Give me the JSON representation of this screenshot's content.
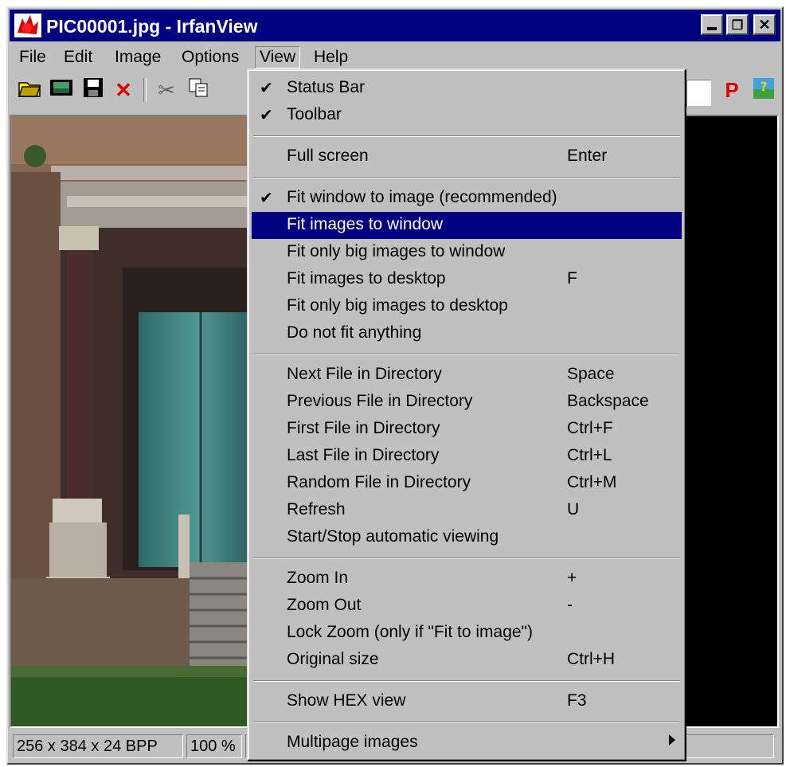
{
  "window": {
    "title": "PIC00001.jpg - IrfanView"
  },
  "menubar": {
    "items": [
      "File",
      "Edit",
      "Image",
      "Options",
      "View",
      "Help"
    ],
    "active": "View"
  },
  "toolbar": {
    "icons": [
      "open-folder-icon",
      "slideshow-icon",
      "save-icon",
      "delete-icon",
      "cut-icon",
      "copy-icon",
      "print-icon",
      "plugin-icon"
    ],
    "right_icon_letter": "P"
  },
  "view_menu": {
    "groups": [
      [
        {
          "label": "Status Bar",
          "checked": true,
          "shortcut": ""
        },
        {
          "label": "Toolbar",
          "checked": true,
          "shortcut": ""
        }
      ],
      [
        {
          "label": "Full screen",
          "checked": false,
          "shortcut": "Enter"
        }
      ],
      [
        {
          "label": "Fit window to image (recommended)",
          "checked": true,
          "shortcut": ""
        },
        {
          "label": "Fit images to window",
          "checked": false,
          "shortcut": "",
          "highlighted": true
        },
        {
          "label": "Fit only big images to window",
          "checked": false,
          "shortcut": ""
        },
        {
          "label": "Fit images to desktop",
          "checked": false,
          "shortcut": "F"
        },
        {
          "label": "Fit only big images to desktop",
          "checked": false,
          "shortcut": ""
        },
        {
          "label": "Do not fit anything",
          "checked": false,
          "shortcut": ""
        }
      ],
      [
        {
          "label": "Next File in Directory",
          "checked": false,
          "shortcut": "Space"
        },
        {
          "label": "Previous File in Directory",
          "checked": false,
          "shortcut": "Backspace"
        },
        {
          "label": "First File in Directory",
          "checked": false,
          "shortcut": "Ctrl+F"
        },
        {
          "label": "Last File in Directory",
          "checked": false,
          "shortcut": "Ctrl+L"
        },
        {
          "label": "Random File in Directory",
          "checked": false,
          "shortcut": "Ctrl+M"
        },
        {
          "label": "Refresh",
          "checked": false,
          "shortcut": "U"
        },
        {
          "label": "Start/Stop automatic viewing",
          "checked": false,
          "shortcut": ""
        }
      ],
      [
        {
          "label": "Zoom In",
          "checked": false,
          "shortcut": "+"
        },
        {
          "label": "Zoom Out",
          "checked": false,
          "shortcut": "-"
        },
        {
          "label": "Lock Zoom (only if \"Fit to image\")",
          "checked": false,
          "shortcut": ""
        },
        {
          "label": "Original size",
          "checked": false,
          "shortcut": "Ctrl+H"
        }
      ],
      [
        {
          "label": "Show HEX view",
          "checked": false,
          "shortcut": "F3"
        }
      ],
      [
        {
          "label": "Multipage images",
          "checked": false,
          "shortcut": "",
          "submenu": true
        }
      ]
    ]
  },
  "statusbar": {
    "dimensions": "256 x 384 x 24 BPP",
    "zoom": "100 %"
  }
}
